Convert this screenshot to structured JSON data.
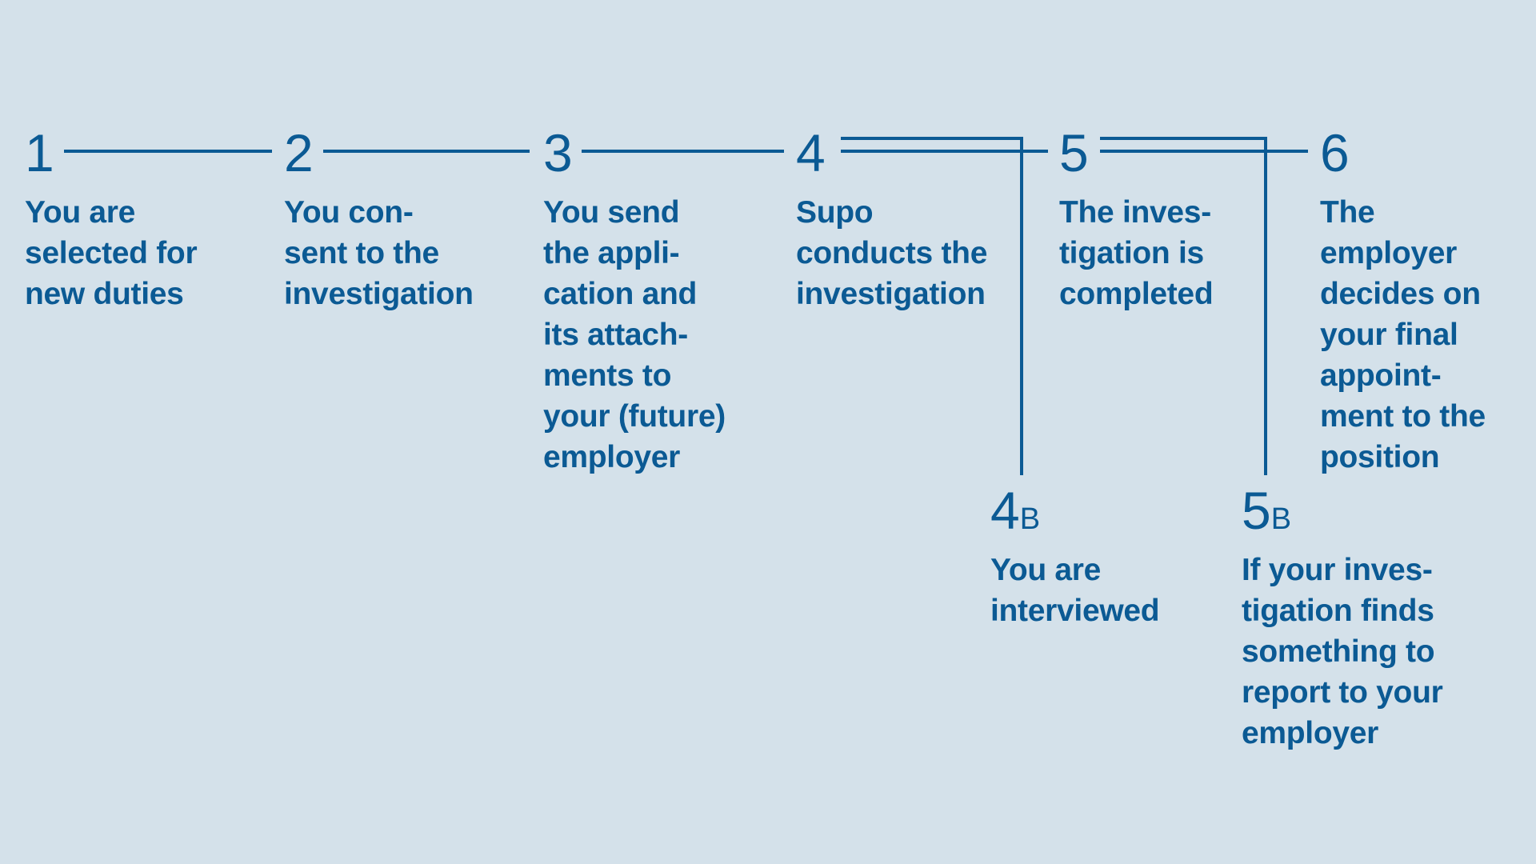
{
  "colors": {
    "background": "#d4e1ea",
    "accent": "#0b5a94"
  },
  "steps": [
    {
      "number": "1",
      "text": "You are\nselected for\nnew duties"
    },
    {
      "number": "2",
      "text": "You con-\nsent to the\ninvestigation"
    },
    {
      "number": "3",
      "text": "You send\nthe appli-\ncation and\nits attach-\nments to\nyour (future)\nemployer"
    },
    {
      "number": "4",
      "text": "Supo\nconducts the\ninvestigation"
    },
    {
      "number": "5",
      "text": "The inves-\ntigation is\ncompleted"
    },
    {
      "number": "6",
      "text": "The\nemployer\ndecides on\nyour final\nappoint-\nment to the\nposition"
    }
  ],
  "branches": [
    {
      "number": "4",
      "suffix": "B",
      "text": "You are\ninterviewed"
    },
    {
      "number": "5",
      "suffix": "B",
      "text": "If your inves-\ntigation finds\nsomething to\nreport to your\nemployer"
    }
  ]
}
